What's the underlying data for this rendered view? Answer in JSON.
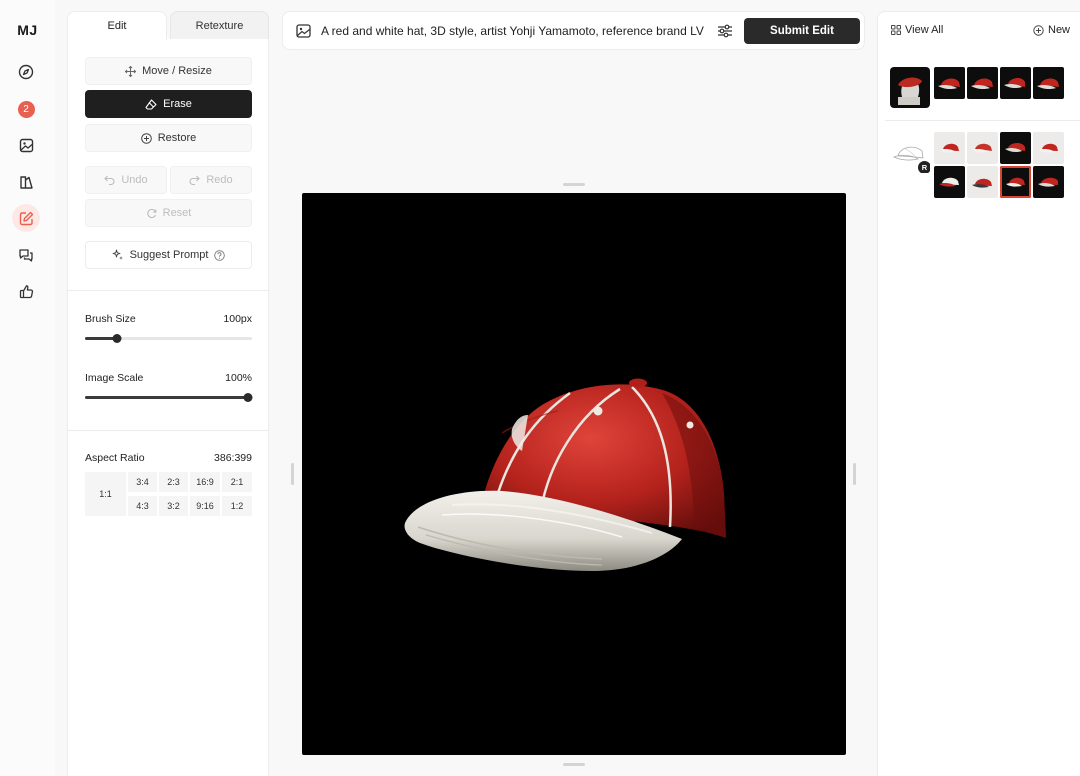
{
  "app": {
    "logo": "MJ"
  },
  "nav": {
    "badge_count": "2",
    "items": [
      {
        "name": "explore-icon"
      },
      {
        "name": "notifications-badge"
      },
      {
        "name": "image-icon"
      },
      {
        "name": "organize-icon"
      },
      {
        "name": "edit-icon",
        "active": true
      },
      {
        "name": "chat-icon"
      },
      {
        "name": "thumbs-up-icon"
      }
    ]
  },
  "tabs": {
    "edit": "Edit",
    "retexture": "Retexture"
  },
  "tools": {
    "move_resize": "Move / Resize",
    "erase": "Erase",
    "restore": "Restore",
    "undo": "Undo",
    "redo": "Redo",
    "reset": "Reset",
    "suggest_prompt": "Suggest Prompt"
  },
  "brush": {
    "label": "Brush Size",
    "value": "100px",
    "fraction": 0.19
  },
  "scale": {
    "label": "Image Scale",
    "value": "100%",
    "fraction": 1.0
  },
  "aspect": {
    "label": "Aspect Ratio",
    "value": "386:399",
    "square": "1:1",
    "top_row": [
      "3:4",
      "2:3",
      "16:9",
      "2:1"
    ],
    "bottom_row": [
      "4:3",
      "3:2",
      "9:16",
      "1:2"
    ]
  },
  "prompt": {
    "text": "A red and white hat, 3D style, artist Yohji Yamamoto, reference brand LV",
    "submit": "Submit Edit"
  },
  "right": {
    "view_all": "View All",
    "new": "New",
    "reference_badge": "R"
  },
  "colors": {
    "accent": "#e8604f",
    "selection": "#d9452e",
    "hat_red": "#c0261f",
    "dark": "#1f1f1f"
  }
}
